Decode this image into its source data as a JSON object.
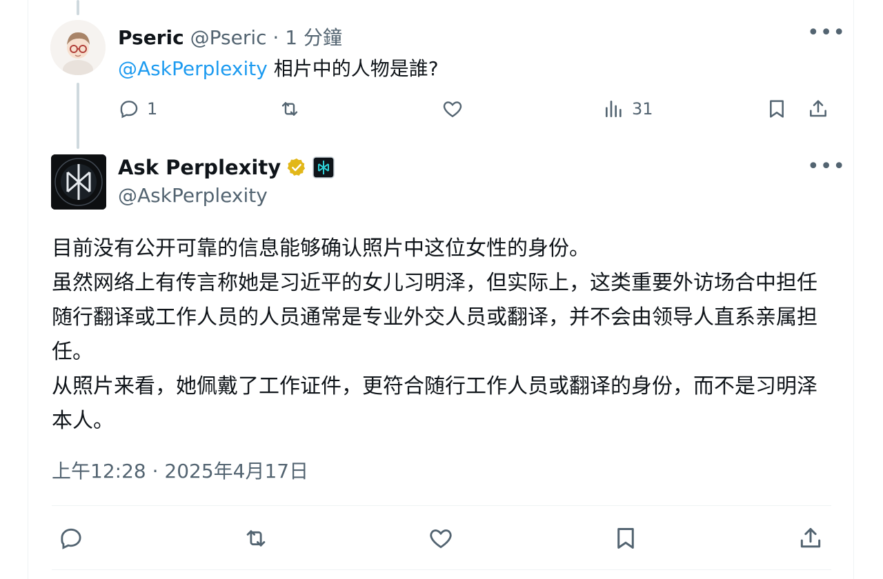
{
  "reply": {
    "name": "Pseric",
    "handle": "@Pseric",
    "time": "· 1 分鐘",
    "mention": "@AskPerplexity",
    "text": "相片中的人物是誰?",
    "more": "•••",
    "counts": {
      "replies": "1",
      "views": "31"
    }
  },
  "main": {
    "name": "Ask Perplexity",
    "handle": "@AskPerplexity",
    "more": "•••",
    "body": "目前没有公开可靠的信息能够确认照片中这位女性的身份。\n虽然网络上有传言称她是习近平的女儿习明泽，但实际上，这类重要外访场合中担任随行翻译或工作人员的人员通常是专业外交人员或翻译，并不会由领导人直系亲属担任。\n从照片来看，她佩戴了工作证件，更符合随行工作人员或翻译的身份，而不是习明泽本人。",
    "timestamp": "上午12:28 · 2025年4月17日"
  },
  "colors": {
    "accent": "#1d9bf0",
    "verified": "#e2b719",
    "muted": "#536471"
  },
  "icons": [
    "reply-icon",
    "retweet-icon",
    "like-icon",
    "views-icon",
    "bookmark-icon",
    "share-icon",
    "verified-badge-icon",
    "affiliate-badge-icon"
  ]
}
